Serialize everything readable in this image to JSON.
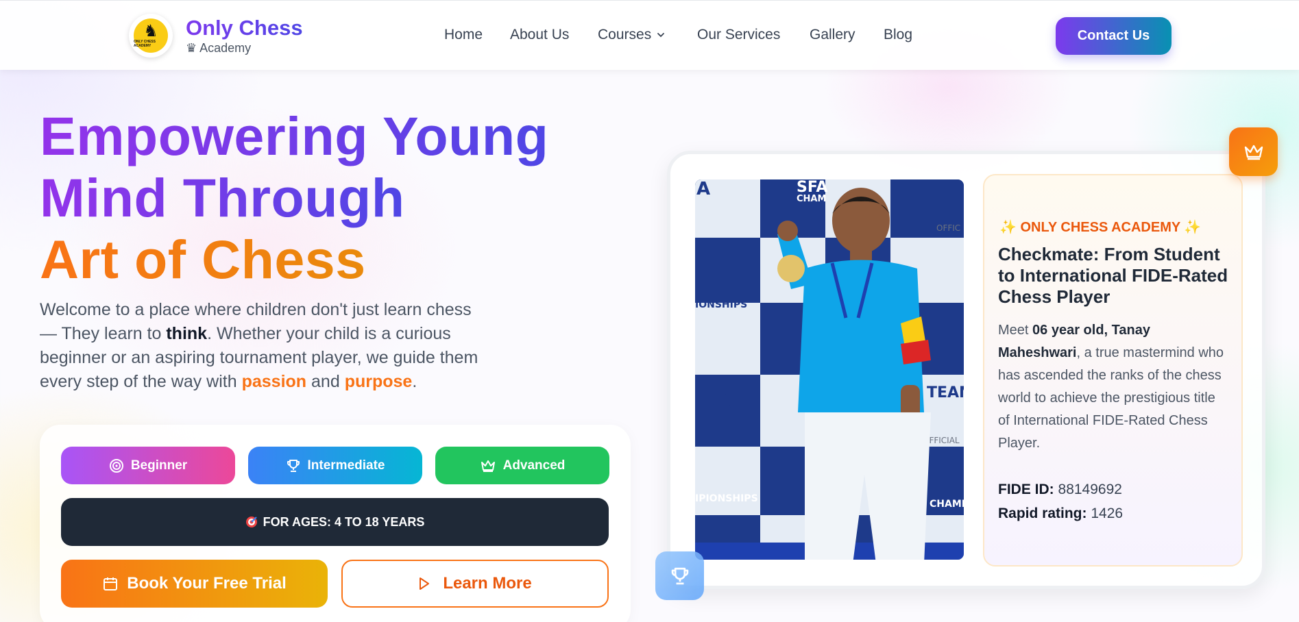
{
  "nav": {
    "logo_text": "ONLY CHESS ACADEMY",
    "brand": "Only Chess",
    "brand_sub": "♛ Academy",
    "menu": [
      "Home",
      "About Us",
      "Courses",
      "Our Services",
      "Gallery",
      "Blog"
    ],
    "contact": "Contact Us"
  },
  "hero": {
    "line1": "Empowering Young",
    "line2": "Mind Through",
    "line3": "Art of Chess",
    "lead_a": "Welcome to a place where children don't just learn chess — They learn to ",
    "lead_think": "think",
    "lead_b": ". Whether your child is a curious beginner or an aspiring tournament player, we guide them every step of the way with ",
    "lead_passion": "passion",
    "lead_and": " and ",
    "lead_purpose": "purpose",
    "lead_end": "."
  },
  "levels": {
    "beginner": "Beginner",
    "intermediate": "Intermediate",
    "advanced": "Advanced",
    "ages": "FOR AGES: 4 TO 18 YEARS",
    "book": "Book Your Free Trial",
    "learn": "Learn More"
  },
  "card": {
    "tag": "✨ ONLY CHESS ACADEMY ✨",
    "title": "Checkmate: From Student to International FIDE-Rated Chess Player",
    "body_a": "Meet ",
    "body_b": "06 year old, Tanay Maheshwari",
    "body_c": ", a true mastermind who has ascended the ranks of the chess world to achieve the prestigious title of International FIDE-Rated Chess Player.",
    "fide_label": "FIDE ID:",
    "fide_value": "88149692",
    "rapid_label": "Rapid rating:",
    "rapid_value": "1426",
    "photo_texts": [
      "SFA",
      "CHAM",
      "OFFIC",
      "IONSHIPS",
      "FA",
      "TEAM",
      "OFFICIAL",
      "IPIONSHIPS",
      "CHAMP"
    ]
  },
  "colors": {
    "primary": "#7c3aed",
    "accent": "#f97316",
    "beginner": "#ec4899",
    "intermediate": "#0ea5e9",
    "advanced": "#22c55e"
  }
}
